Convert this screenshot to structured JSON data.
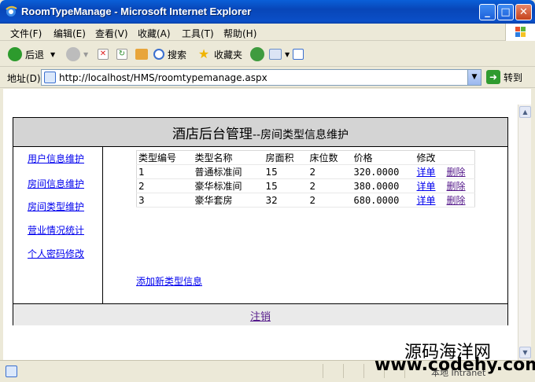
{
  "window": {
    "title": "RoomTypeManage - Microsoft Internet Explorer",
    "minimize": "_",
    "maximize": "□",
    "close": "✕"
  },
  "menu": [
    "文件(F)",
    "编辑(E)",
    "查看(V)",
    "收藏(A)",
    "工具(T)",
    "帮助(H)"
  ],
  "toolbar": {
    "back": "后退",
    "search": "搜索",
    "favorites": "收藏夹"
  },
  "address": {
    "label": "地址(D)",
    "url": "http://localhost/HMS/roomtypemanage.aspx",
    "go": "转到"
  },
  "page": {
    "header_title": "酒店后台管理",
    "header_subtitle": "--房间类型信息维护",
    "sidebar": [
      "用户信息维护",
      "房间信息维护",
      "房间类型维护",
      "营业情况统计",
      "个人密码修改"
    ],
    "table": {
      "headers": [
        "类型编号",
        "类型名称",
        "房面积",
        "床位数",
        "价格",
        "修改",
        ""
      ],
      "rows": [
        {
          "id": "1",
          "name": "普通标准间",
          "area": "15",
          "beds": "2",
          "price": "320.0000",
          "detail": "详单",
          "delete": "删除"
        },
        {
          "id": "2",
          "name": "豪华标准间",
          "area": "15",
          "beds": "2",
          "price": "380.0000",
          "detail": "详单",
          "delete": "删除"
        },
        {
          "id": "3",
          "name": "豪华套房",
          "area": "32",
          "beds": "2",
          "price": "680.0000",
          "detail": "详单",
          "delete": "删除"
        }
      ]
    },
    "add_link": "添加新类型信息",
    "logout": "注销"
  },
  "watermark": {
    "line1": "源码海洋网",
    "line2": "www.codehy.com"
  },
  "statusbar": {
    "zone": "本地 Intranet"
  }
}
